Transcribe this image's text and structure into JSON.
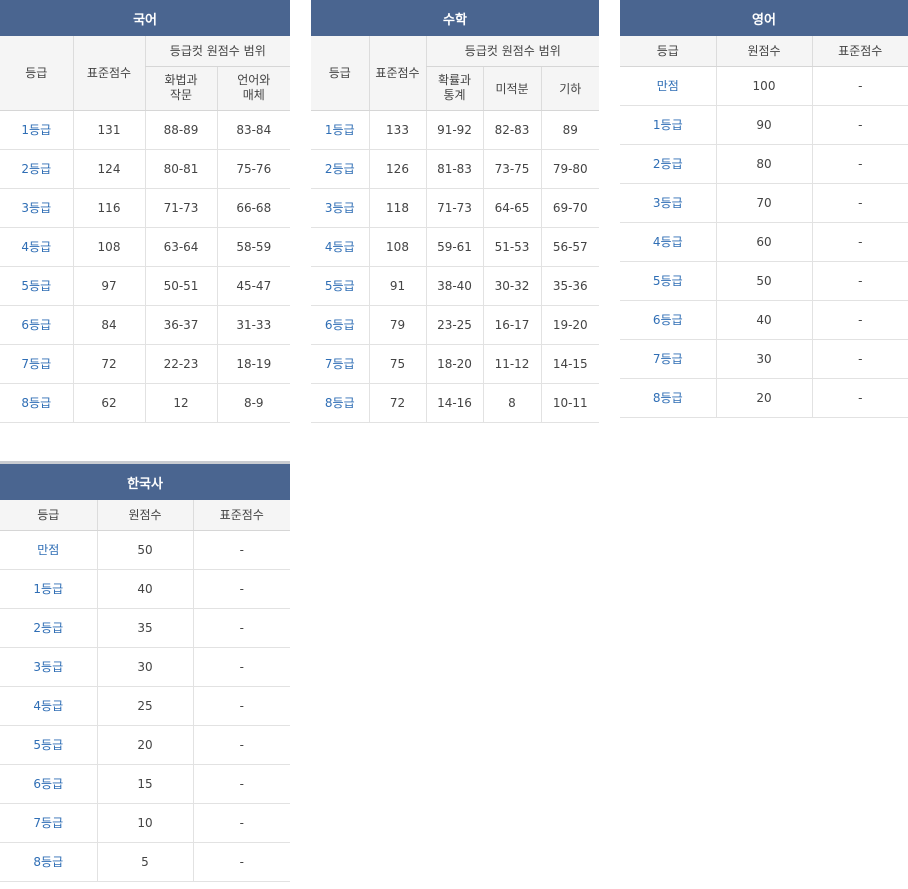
{
  "korean": {
    "title": "국어",
    "head": {
      "grade": "등급",
      "std": "표준점수",
      "range": "등급컷 원점수 범위",
      "sub1a": "화법과",
      "sub1b": "작문",
      "sub2a": "언어와",
      "sub2b": "매체"
    },
    "rows": [
      {
        "grade": "1등급",
        "std": "131",
        "s1": "88-89",
        "s2": "83-84"
      },
      {
        "grade": "2등급",
        "std": "124",
        "s1": "80-81",
        "s2": "75-76"
      },
      {
        "grade": "3등급",
        "std": "116",
        "s1": "71-73",
        "s2": "66-68"
      },
      {
        "grade": "4등급",
        "std": "108",
        "s1": "63-64",
        "s2": "58-59"
      },
      {
        "grade": "5등급",
        "std": "97",
        "s1": "50-51",
        "s2": "45-47"
      },
      {
        "grade": "6등급",
        "std": "84",
        "s1": "36-37",
        "s2": "31-33"
      },
      {
        "grade": "7등급",
        "std": "72",
        "s1": "22-23",
        "s2": "18-19"
      },
      {
        "grade": "8등급",
        "std": "62",
        "s1": "12",
        "s2": "8-9"
      }
    ]
  },
  "math": {
    "title": "수학",
    "head": {
      "grade": "등급",
      "std": "표준점수",
      "range": "등급컷 원점수 범위",
      "sub1a": "확률과",
      "sub1b": "통계",
      "sub2": "미적분",
      "sub3": "기하"
    },
    "rows": [
      {
        "grade": "1등급",
        "std": "133",
        "s1": "91-92",
        "s2": "82-83",
        "s3": "89"
      },
      {
        "grade": "2등급",
        "std": "126",
        "s1": "81-83",
        "s2": "73-75",
        "s3": "79-80"
      },
      {
        "grade": "3등급",
        "std": "118",
        "s1": "71-73",
        "s2": "64-65",
        "s3": "69-70"
      },
      {
        "grade": "4등급",
        "std": "108",
        "s1": "59-61",
        "s2": "51-53",
        "s3": "56-57"
      },
      {
        "grade": "5등급",
        "std": "91",
        "s1": "38-40",
        "s2": "30-32",
        "s3": "35-36"
      },
      {
        "grade": "6등급",
        "std": "79",
        "s1": "23-25",
        "s2": "16-17",
        "s3": "19-20"
      },
      {
        "grade": "7등급",
        "std": "75",
        "s1": "18-20",
        "s2": "11-12",
        "s3": "14-15"
      },
      {
        "grade": "8등급",
        "std": "72",
        "s1": "14-16",
        "s2": "8",
        "s3": "10-11"
      }
    ]
  },
  "english": {
    "title": "영어",
    "head": {
      "grade": "등급",
      "raw": "원점수",
      "std": "표준점수"
    },
    "rows": [
      {
        "grade": "만점",
        "raw": "100",
        "std": "-"
      },
      {
        "grade": "1등급",
        "raw": "90",
        "std": "-"
      },
      {
        "grade": "2등급",
        "raw": "80",
        "std": "-"
      },
      {
        "grade": "3등급",
        "raw": "70",
        "std": "-"
      },
      {
        "grade": "4등급",
        "raw": "60",
        "std": "-"
      },
      {
        "grade": "5등급",
        "raw": "50",
        "std": "-"
      },
      {
        "grade": "6등급",
        "raw": "40",
        "std": "-"
      },
      {
        "grade": "7등급",
        "raw": "30",
        "std": "-"
      },
      {
        "grade": "8등급",
        "raw": "20",
        "std": "-"
      }
    ]
  },
  "history": {
    "title": "한국사",
    "head": {
      "grade": "등급",
      "raw": "원점수",
      "std": "표준점수"
    },
    "rows": [
      {
        "grade": "만점",
        "raw": "50",
        "std": "-"
      },
      {
        "grade": "1등급",
        "raw": "40",
        "std": "-"
      },
      {
        "grade": "2등급",
        "raw": "35",
        "std": "-"
      },
      {
        "grade": "3등급",
        "raw": "30",
        "std": "-"
      },
      {
        "grade": "4등급",
        "raw": "25",
        "std": "-"
      },
      {
        "grade": "5등급",
        "raw": "20",
        "std": "-"
      },
      {
        "grade": "6등급",
        "raw": "15",
        "std": "-"
      },
      {
        "grade": "7등급",
        "raw": "10",
        "std": "-"
      },
      {
        "grade": "8등급",
        "raw": "5",
        "std": "-"
      }
    ]
  }
}
